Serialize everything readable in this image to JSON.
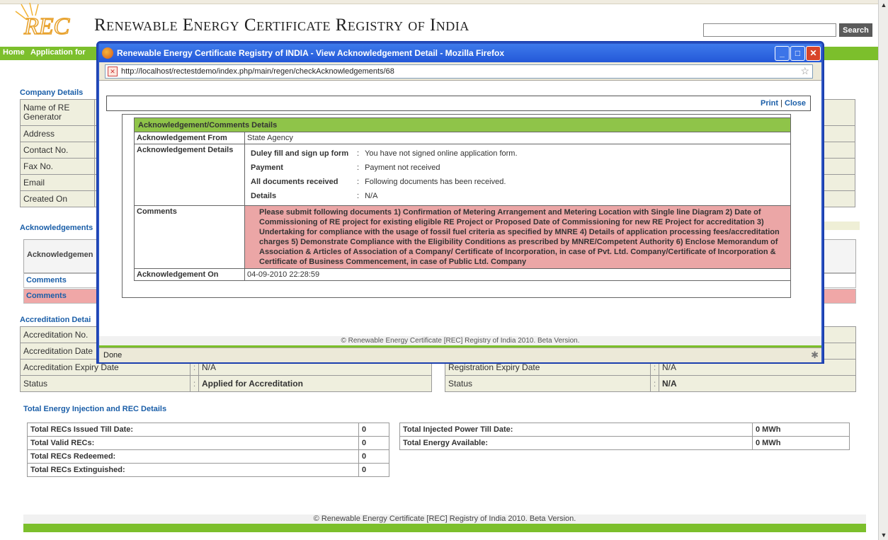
{
  "site": {
    "logo_text": "REC",
    "title": "Renewable Energy Certificate Registry of India",
    "search_button": "Search",
    "search_value": ""
  },
  "nav": {
    "items": [
      "Home",
      "Application for"
    ]
  },
  "company": {
    "heading": "Company Details",
    "rows": [
      "Name of RE Generator",
      "Address",
      "Contact No.",
      "Fax No.",
      "Email",
      "Created On"
    ]
  },
  "acknowledgements": {
    "heading": "Acknowledgements",
    "column_header": "Acknowledgemen",
    "rows": [
      "Comments",
      "Comments"
    ]
  },
  "accreditation": {
    "heading": "Accreditation Detai",
    "left_rows": [
      {
        "label": "Accreditation No.",
        "value": ""
      },
      {
        "label": "Accreditation Date",
        "value": ""
      },
      {
        "label": "Accreditation Expiry Date",
        "value": "N/A"
      },
      {
        "label": "Status",
        "value": "Applied for Accreditation"
      }
    ],
    "right_rows": [
      {
        "label": "Registration Expiry Date",
        "value": "N/A"
      },
      {
        "label": "Status",
        "value": "N/A"
      }
    ]
  },
  "totals": {
    "heading": "Total Energy Injection and REC Details",
    "left": [
      {
        "label": "Total RECs Issued Till Date:",
        "value": "0"
      },
      {
        "label": "Total Valid RECs:",
        "value": "0"
      },
      {
        "label": "Total RECs Redeemed:",
        "value": "0"
      },
      {
        "label": "Total RECs Extinguished:",
        "value": "0"
      }
    ],
    "right": [
      {
        "label": "Total Injected Power Till Date:",
        "value": "0 MWh"
      },
      {
        "label": "Total Energy Available:",
        "value": "0 MWh"
      }
    ]
  },
  "footer": "© Renewable Energy Certificate [REC] Registry of India 2010. Beta Version.",
  "popup": {
    "window_title": "Renewable Energy Certificate Registry of INDIA - View Acknowledgement Detail - Mozilla Firefox",
    "url": "http://localhost/rectestdemo/index.php/main/regen/checkAcknowledgements/68",
    "print_label": "Print",
    "link_separator": "|",
    "close_label": "Close",
    "status": "Done",
    "footer": "© Renewable Energy Certificate [REC] Registry of India 2010. Beta Version.",
    "details": {
      "header": "Acknowledgement/Comments Details",
      "from_label": "Acknowledgement From",
      "from_value": "State Agency",
      "details_label": "Acknowledgement Details",
      "items": [
        {
          "label": "Duley fill and sign up form",
          "sep": ":",
          "value": "You have not signed online application form."
        },
        {
          "label": "Payment",
          "sep": ":",
          "value": "Payment not received"
        },
        {
          "label": "All documents received",
          "sep": ":",
          "value": "Following documents has been received."
        },
        {
          "label": "Details",
          "sep": ":",
          "value": "N/A"
        }
      ],
      "comments_label": "Comments",
      "comments_value": "Please submit following documents 1) Confirmation of Metering Arrangement and Metering Location with Single line Diagram 2) Date of Commissioning of RE project for existing eligible RE Project or Proposed Date of Commissioning for new RE Project for accreditation 3) Undertaking for compliance with the usage of fossil fuel criteria as specified by MNRE 4) Details of application processing fees/accreditation charges 5) Demonstrate Compliance with the Eligibility Conditions as prescribed by MNRE/Competent Authority 6) Enclose Memorandum of Association & Articles of Association of a Company/ Certificate of Incorporation, in case of Pvt. Ltd. Company/Certificate of Incorporation & Certificate of Business Commencement, in case of Public Ltd. Company",
      "on_label": "Acknowledgement On",
      "on_value": "04-09-2010 22:28:59"
    }
  },
  "colors": {
    "brand_green": "#7cbf2c",
    "link_blue": "#1a5ea8",
    "comment_pink": "#eba6a6",
    "window_blue": "#2458d8"
  }
}
